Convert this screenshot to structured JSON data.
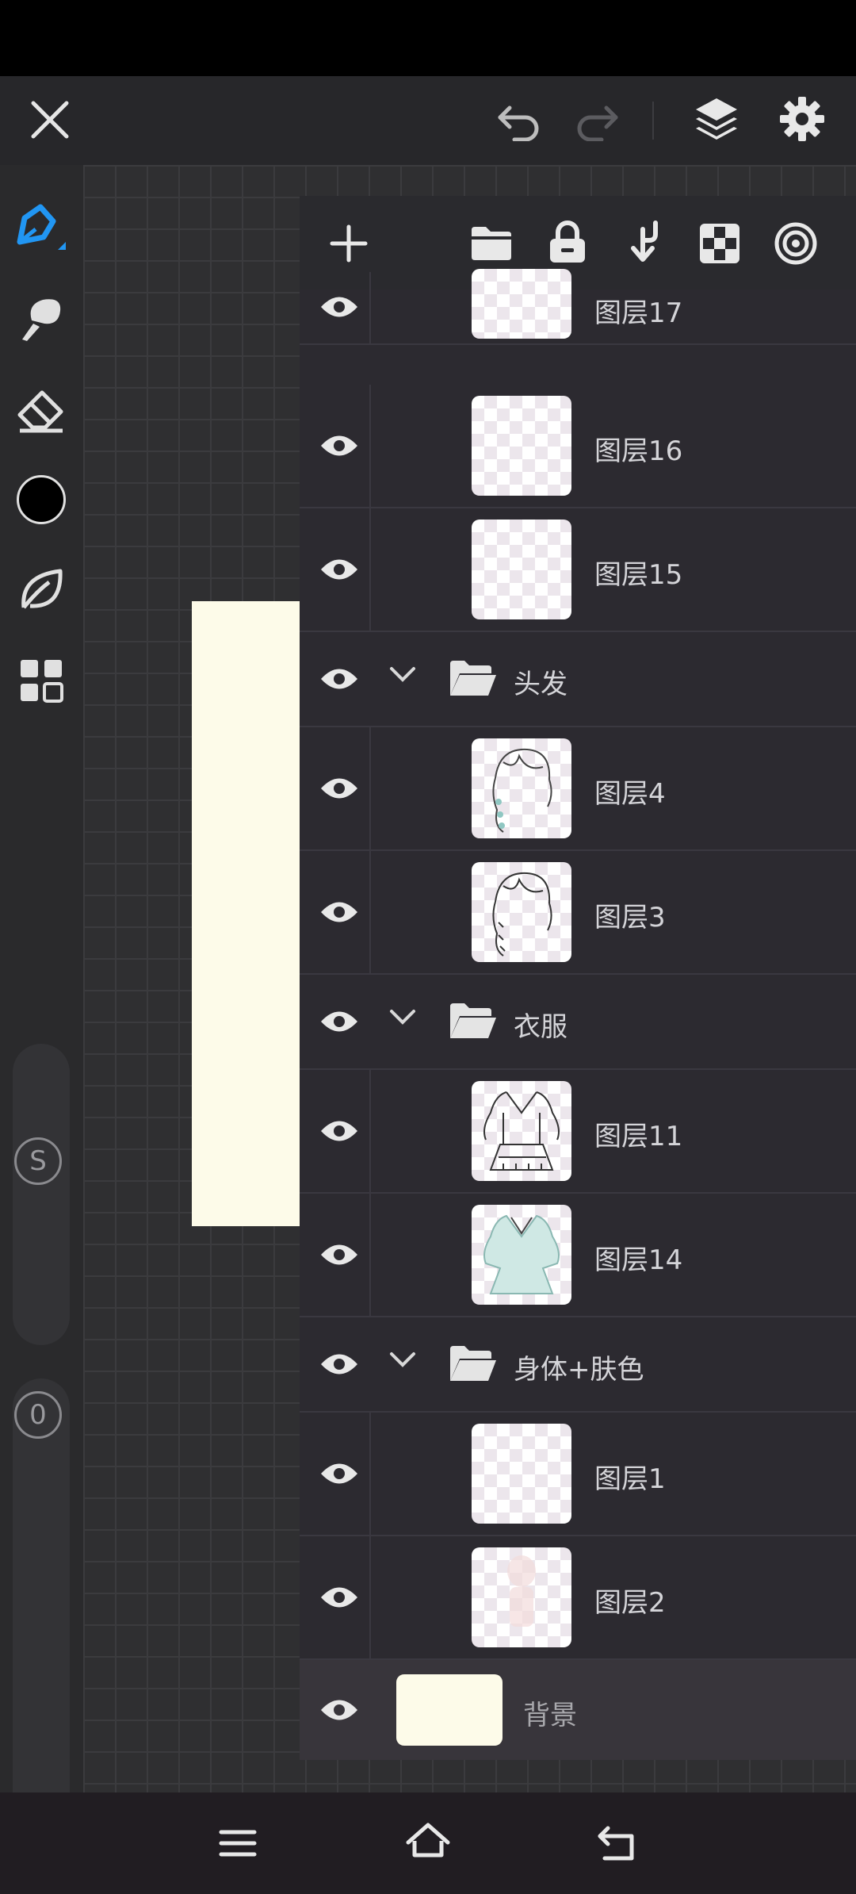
{
  "colors": {
    "accent": "#2196f3",
    "background_color_swatch": "#fdfbe9",
    "current_color": "#000000"
  },
  "topbar": {
    "close_icon": "close-icon",
    "undo_icon": "undo-icon",
    "redo_icon": "redo-icon",
    "layers_icon": "layers-icon",
    "settings_icon": "gear-icon"
  },
  "toolbar": {
    "tools": [
      "pen-icon",
      "brush-icon",
      "eraser-icon",
      "color-swatch",
      "leaf-icon",
      "grid-icon"
    ],
    "size_slider_label": "S",
    "opacity_slider_label": "0"
  },
  "layers_panel": {
    "header_icons": [
      "add-icon",
      "folder-icon",
      "lock-icon",
      "merge-down-icon",
      "checker-icon",
      "target-icon"
    ],
    "rows": [
      {
        "type": "layer",
        "name": "图层17"
      },
      {
        "type": "layer",
        "name": "图层16"
      },
      {
        "type": "layer",
        "name": "图层15"
      },
      {
        "type": "group",
        "name": "头发"
      },
      {
        "type": "layer",
        "name": "图层4"
      },
      {
        "type": "layer",
        "name": "图层3"
      },
      {
        "type": "group",
        "name": "衣服"
      },
      {
        "type": "layer",
        "name": "图层11"
      },
      {
        "type": "layer",
        "name": "图层14"
      },
      {
        "type": "group",
        "name": "身体+肤色"
      },
      {
        "type": "layer",
        "name": "图层1"
      },
      {
        "type": "layer",
        "name": "图层2"
      },
      {
        "type": "background",
        "name": "背景"
      }
    ]
  },
  "navbar": {
    "icons": [
      "menu-icon",
      "home-icon",
      "back-icon"
    ]
  }
}
